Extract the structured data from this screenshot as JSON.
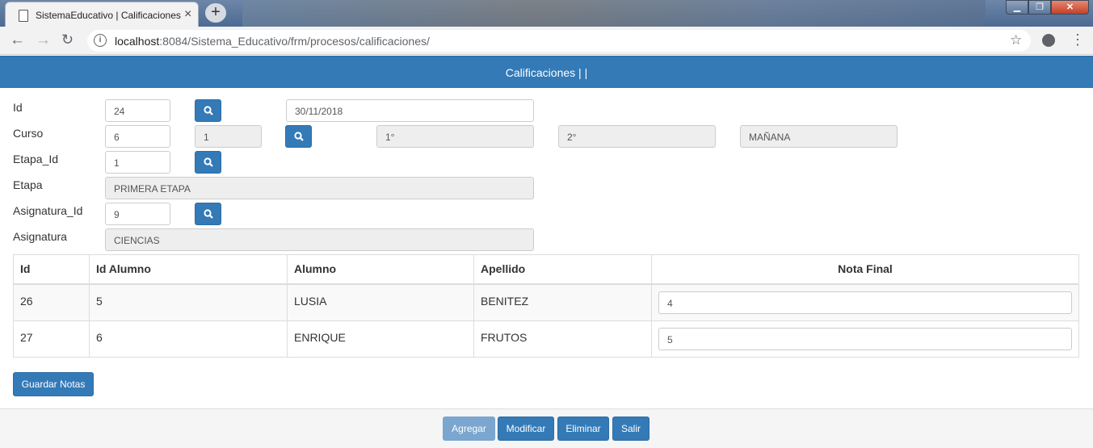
{
  "browser": {
    "tab_title": "SistemaEducativo | Calificaciones",
    "url_host": "localhost",
    "url_rest": ":8084/Sistema_Educativo/frm/procesos/calificaciones/"
  },
  "header": {
    "title": "Calificaciones | |"
  },
  "form": {
    "id_label": "Id",
    "id_value": "24",
    "fecha_value": "30/11/2018",
    "curso_label": "Curso",
    "curso_value": "6",
    "curso_code": "1",
    "curso_a": "1°",
    "curso_b": "2°",
    "turno": "MAÑANA",
    "etapa_id_label": "Etapa_Id",
    "etapa_id_value": "1",
    "etapa_label": "Etapa",
    "etapa_value": "PRIMERA ETAPA",
    "asignatura_id_label": "Asignatura_Id",
    "asignatura_id_value": "9",
    "asignatura_label": "Asignatura",
    "asignatura_value": "CIENCIAS"
  },
  "table": {
    "headers": [
      "Id",
      "Id Alumno",
      "Alumno",
      "Apellido",
      "Nota Final"
    ],
    "rows": [
      {
        "id": "26",
        "id_alumno": "5",
        "alumno": "LUSIA",
        "apellido": "BENITEZ",
        "nota": "4"
      },
      {
        "id": "27",
        "id_alumno": "6",
        "alumno": "ENRIQUE",
        "apellido": "FRUTOS",
        "nota": "5"
      }
    ]
  },
  "buttons": {
    "guardar_notas": "Guardar Notas",
    "agregar": "Agregar",
    "modificar": "Modificar",
    "eliminar": "Eliminar",
    "salir": "Salir"
  },
  "icons": {
    "search": "search-icon"
  },
  "colors": {
    "primary": "#337ab7",
    "disabled": "#7aa6cf"
  }
}
